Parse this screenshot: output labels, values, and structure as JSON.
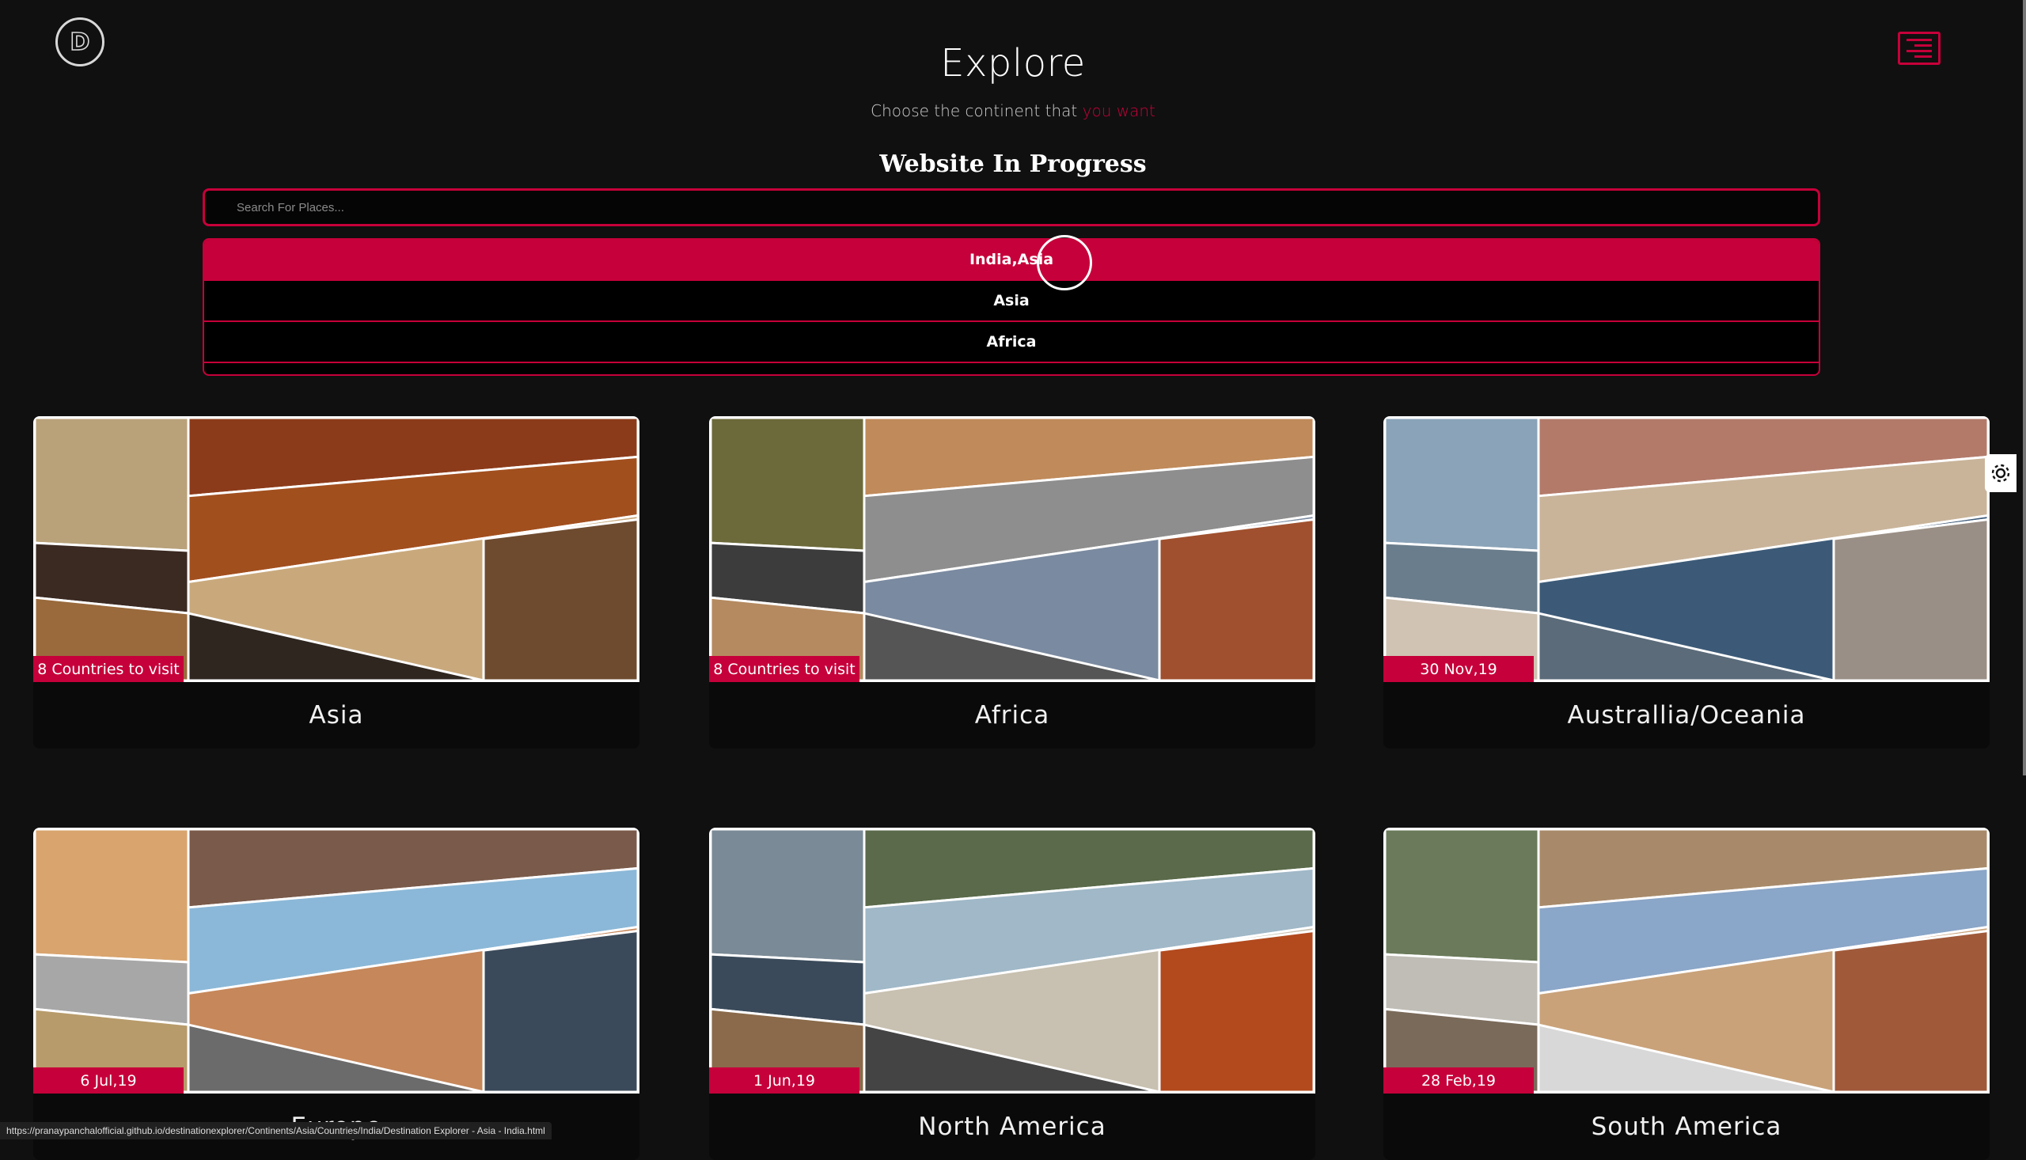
{
  "header": {
    "logo_letter": "D",
    "title": "Explore",
    "subtitle_prefix": "Choose the continent that ",
    "subtitle_accent": "you want",
    "notice": "Website In Progress"
  },
  "search": {
    "placeholder": "Search For Places...",
    "value": ""
  },
  "results": [
    "India,Asia",
    "Asia",
    "Africa"
  ],
  "cards": [
    {
      "title": "Asia",
      "badge": "8 Countries to visit"
    },
    {
      "title": "Africa",
      "badge": "8 Countries to visit"
    },
    {
      "title": "Australlia/Oceania",
      "badge": "30 Nov,19"
    },
    {
      "title": "Europe",
      "badge": "6 Jul,19"
    },
    {
      "title": "North America",
      "badge": "1 Jun,19"
    },
    {
      "title": "South America",
      "badge": "28 Feb,19"
    }
  ],
  "status_url": "https://pranaypanchalofficial.github.io/destinationexplorer/Continents/Asia/Countries/India/Destination Explorer - Asia - India.html",
  "icons": {
    "menu": "menu-icon",
    "settings": "gear-icon",
    "logo": "logo-icon"
  },
  "colors": {
    "accent": "#c6003a",
    "background": "#101010",
    "card": "#0a0a0a"
  }
}
